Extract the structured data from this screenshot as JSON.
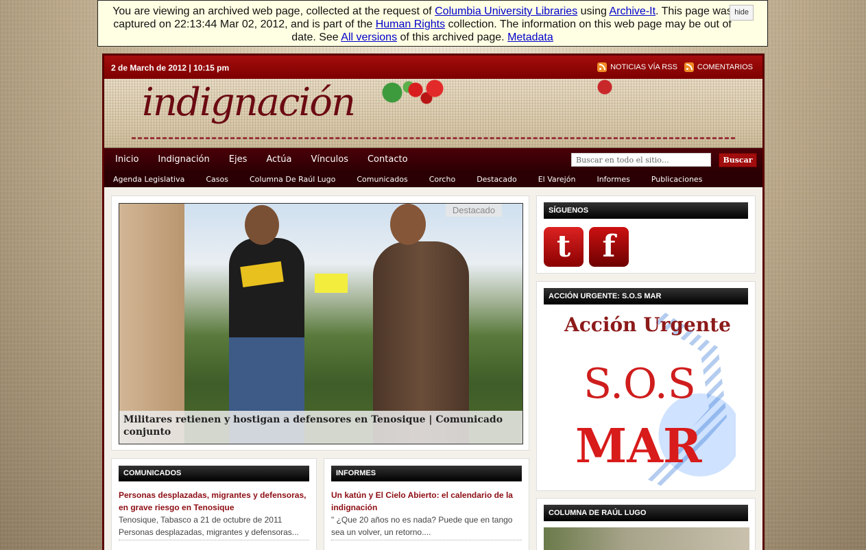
{
  "archive": {
    "t1": "You are viewing an archived web page, collected at the request of ",
    "link_cul": "Columbia University Libraries",
    "t2": " using ",
    "link_ait": "Archive-It",
    "t3": ". This page was captured on 22:13:44 Mar 02, 2012, and is part of the ",
    "link_hr": "Human Rights",
    "t4": " collection. The information on this web page may be out of date. See ",
    "link_versions": "All versions",
    "t5": " of this archived page. ",
    "link_meta": "Metadata",
    "hide": "hide"
  },
  "topbar": {
    "date": "2 de March de 2012 | 10:15 pm",
    "rss": "NOTICIAS VÍA RSS",
    "comments": "COMENTARIOS"
  },
  "header": {
    "logo": "indignación"
  },
  "nav": {
    "items": [
      "Inicio",
      "Indignación",
      "Ejes",
      "Actúa",
      "Vínculos",
      "Contacto"
    ],
    "search_placeholder": "Buscar en todo el sitio…",
    "search_button": "Buscar"
  },
  "subnav": {
    "items": [
      "Agenda Legislativa",
      "Casos",
      "Columna De Raúl Lugo",
      "Comunicados",
      "Corcho",
      "Destacado",
      "El Varejón",
      "Informes",
      "Publicaciones"
    ]
  },
  "featured": {
    "tag": "Destacado",
    "caption": "Militares retienen y hostigan a defensores en Tenosique | Comunicado conjunto"
  },
  "comunicados": {
    "title": "COMUNICADOS",
    "post_title": "Personas desplazadas, migrantes y defensoras, en grave riesgo en Tenosique",
    "excerpt": "Tenosique, Tabasco a 21 de octubre de 2011 Personas desplazadas, migrantes y defensoras..."
  },
  "informes": {
    "title": "INFORMES",
    "post_title": "Un katún y El Cielo Abierto: el calendario de la indignación",
    "excerpt": "\" ¿Que 20 años no es nada? Puede que en tango sea un volver, un retorno...."
  },
  "sidebar": {
    "siguenos": "SÍGUENOS",
    "accion": "ACCIÓN URGENTE: S.O.S MAR",
    "accion_l1": "Acción Urgente",
    "accion_l2": "S.O.S",
    "accion_l3": "MAR",
    "columna": "COLUMNA DE RAÚL LUGO"
  },
  "colors": {
    "brand": "#8d0e14",
    "nav": "#2c0004",
    "accent": "#a10d0d"
  }
}
